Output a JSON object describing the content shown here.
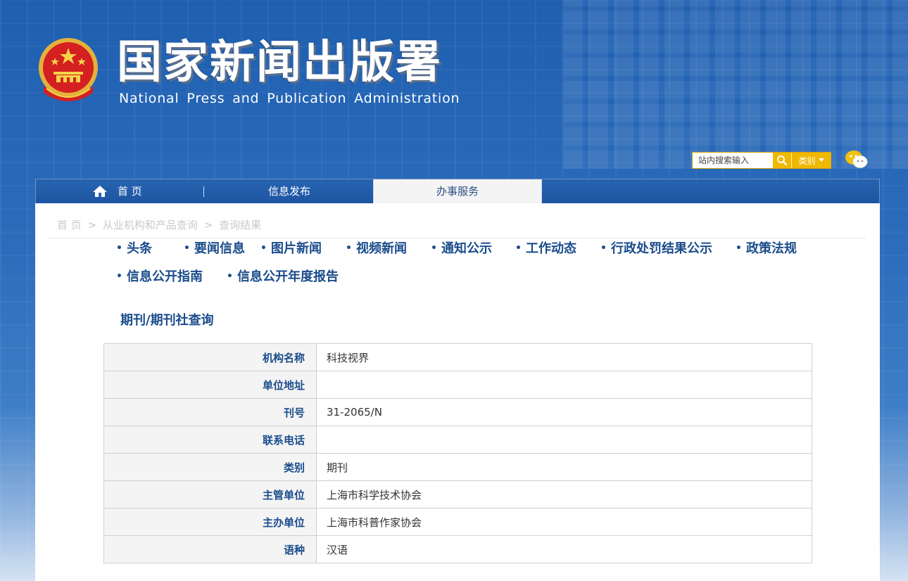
{
  "header": {
    "title": "国家新闻出版署",
    "subtitle": "National  Press and Publication Administration"
  },
  "search": {
    "placeholder": "站内搜索输入",
    "category_label": "类别"
  },
  "nav": {
    "home_label": "首 页",
    "info_label": "信息发布",
    "service_label": "办事服务"
  },
  "breadcrumb": {
    "items": [
      "首 页",
      ">",
      "从业机构和产品查询",
      ">",
      "查询结果"
    ]
  },
  "subnav": {
    "items": [
      "头条",
      "要闻信息",
      "图片新闻",
      "视频新闻",
      "通知公示",
      "工作动态",
      "行政处罚结果公示",
      "政策法规",
      "信息公开指南",
      "信息公开年度报告"
    ]
  },
  "section_title": "期刊/期刊社查询",
  "record": {
    "rows": [
      {
        "label": "机构名称",
        "value": "科技视界"
      },
      {
        "label": "单位地址",
        "value": ""
      },
      {
        "label": "刊号",
        "value": "31-2065/N"
      },
      {
        "label": "联系电话",
        "value": ""
      },
      {
        "label": "类别",
        "value": "期刊"
      },
      {
        "label": "主管单位",
        "value": "上海市科学技术协会"
      },
      {
        "label": "主办单位",
        "value": "上海市科普作家协会"
      },
      {
        "label": "语种",
        "value": "汉语"
      }
    ]
  },
  "colors": {
    "brand_blue": "#1a4c8c",
    "search_gold": "#f0b800"
  }
}
